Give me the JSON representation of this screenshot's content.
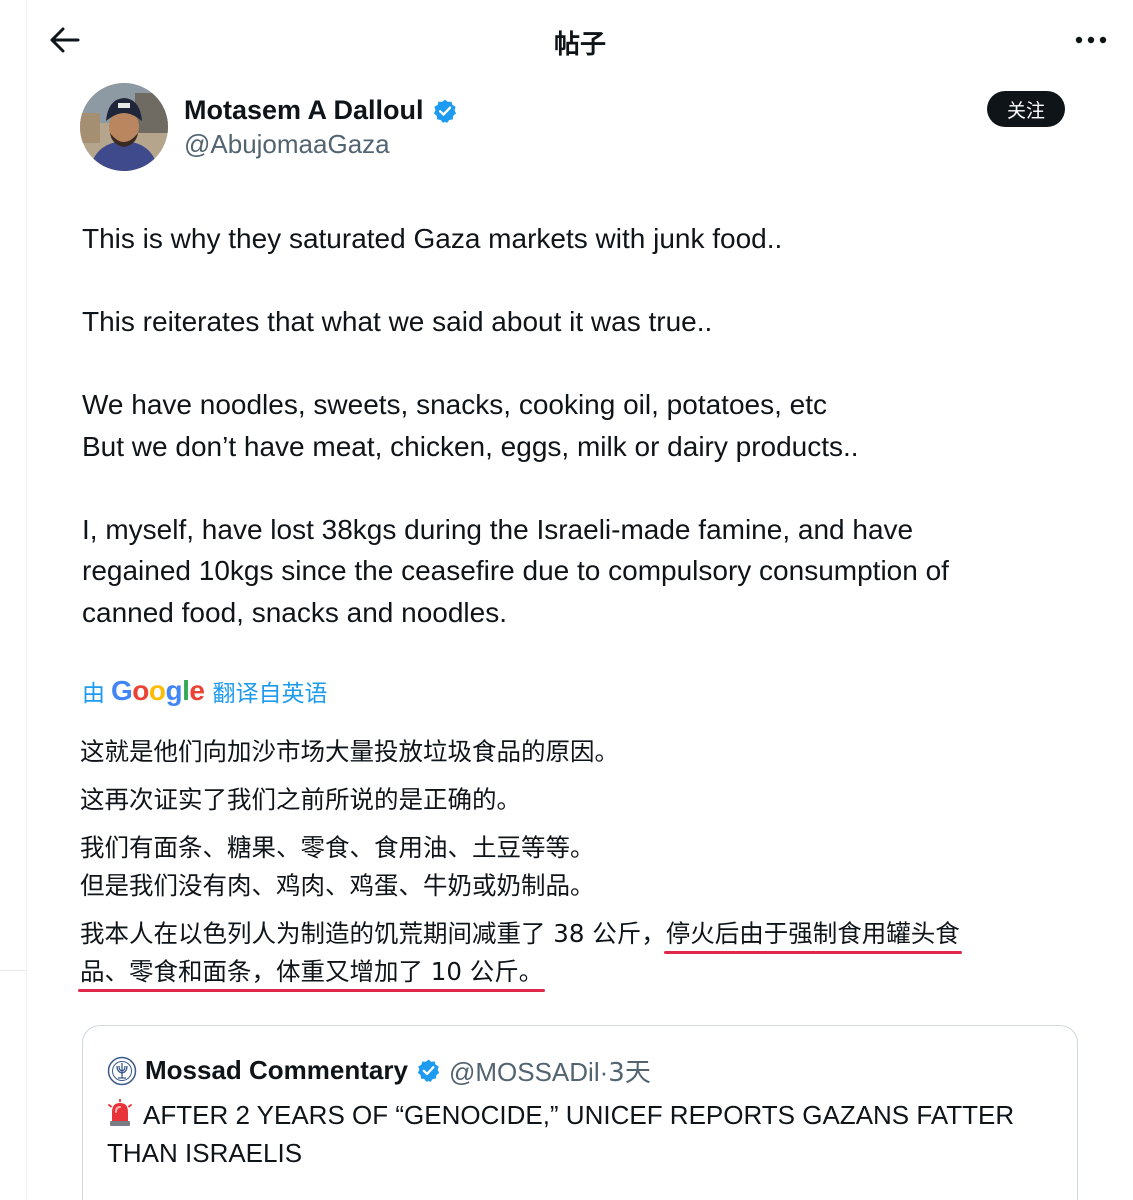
{
  "header": {
    "title": "帖子",
    "back_icon": "arrow-left-icon",
    "more_icon": "more-horizontal-icon"
  },
  "author": {
    "name": "Motasem A Dalloul",
    "handle": "@AbujomaaGaza",
    "verified": true,
    "follow_label": "关注"
  },
  "post": {
    "paragraphs": [
      [
        "This is why they saturated Gaza markets with junk food.."
      ],
      [
        "This reiterates that what we said about it was true.."
      ],
      [
        "We have noodles, sweets, snacks, cooking oil, potatoes, etc",
        "But we don’t have meat, chicken, eggs, milk or dairy products.."
      ],
      [
        "I, myself, have lost 38kgs during the Israeli-made famine, and have",
        "regained 10kgs since the ceasefire due to compulsory consumption of",
        "canned food, snacks and noodles."
      ]
    ]
  },
  "translation": {
    "prefix": "由",
    "provider": "Google",
    "suffix": "翻译自英语",
    "lines": {
      "l1": "这就是他们向加沙市场大量投放垃圾食品的原因。",
      "l2": "这再次证实了我们之前所说的是正确的。",
      "l3": "我们有面条、糖果、零食、食用油、土豆等等。",
      "l4": "但是我们没有肉、鸡肉、鸡蛋、牛奶或奶制品。",
      "l5a": "我本人在以色列人为制造的饥荒期间减重了 38 公斤，",
      "l5b": "停火后由于强制食用罐头食",
      "l6": "品、零食和面条，体重又增加了 10 公斤。"
    },
    "highlight_color": "#e0284a"
  },
  "quoted": {
    "name": "Mossad Commentary",
    "handle": "@MOSSADil",
    "separator": "·",
    "time": "3天",
    "verified": true,
    "text": "AFTER 2 YEARS OF “GENOCIDE,” UNICEF REPORTS GAZANS FATTER THAN ISRAELIS",
    "text_icon": "siren-icon"
  },
  "colors": {
    "accent": "#1d9bf0",
    "text": "#0f1419",
    "muted": "#536471",
    "border": "#cfd9de"
  }
}
